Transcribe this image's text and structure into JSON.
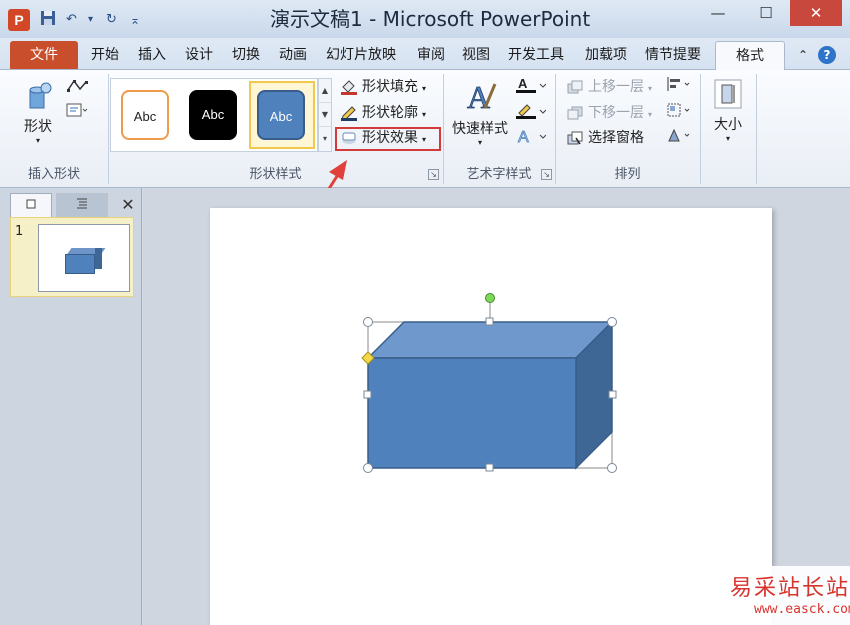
{
  "window": {
    "title": "演示文稿1 - Microsoft PowerPoint",
    "app_icon": "P",
    "minimize": "—",
    "maximize": "☐",
    "close": "✕"
  },
  "quick_access": {
    "save": "💾",
    "undo": "↶",
    "undo_drop": "▾",
    "redo": "↻",
    "customize": "⌅"
  },
  "tabs": {
    "file": "文件",
    "items": [
      "开始",
      "插入",
      "设计",
      "切换",
      "动画",
      "幻灯片放映",
      "审阅",
      "视图",
      "开发工具",
      "加载项",
      "情节提要"
    ],
    "active": "格式",
    "minimize_ribbon": "⌃",
    "help": "?"
  },
  "ribbon": {
    "insert_shapes": {
      "shapes_label": "形状",
      "group_label": "插入形状"
    },
    "shape_styles": {
      "swatch_text": "Abc",
      "fill": "形状填充",
      "outline": "形状轮廓",
      "effects": "形状效果",
      "group_label": "形状样式"
    },
    "wordart": {
      "quick_styles": "快速样式",
      "group_label": "艺术字样式"
    },
    "arrange": {
      "bring_forward": "上移一层",
      "send_backward": "下移一层",
      "selection_pane": "选择窗格",
      "group_label": "排列"
    },
    "size": {
      "label": "大小"
    }
  },
  "left_panel": {
    "slide_number": "1",
    "close": "✕"
  },
  "colors": {
    "accent": "#4f81bd",
    "file_tab": "#c94f2c",
    "highlight": "#d33a3a"
  },
  "watermark": {
    "title": "易采站长站",
    "url": "www.easck.com"
  }
}
